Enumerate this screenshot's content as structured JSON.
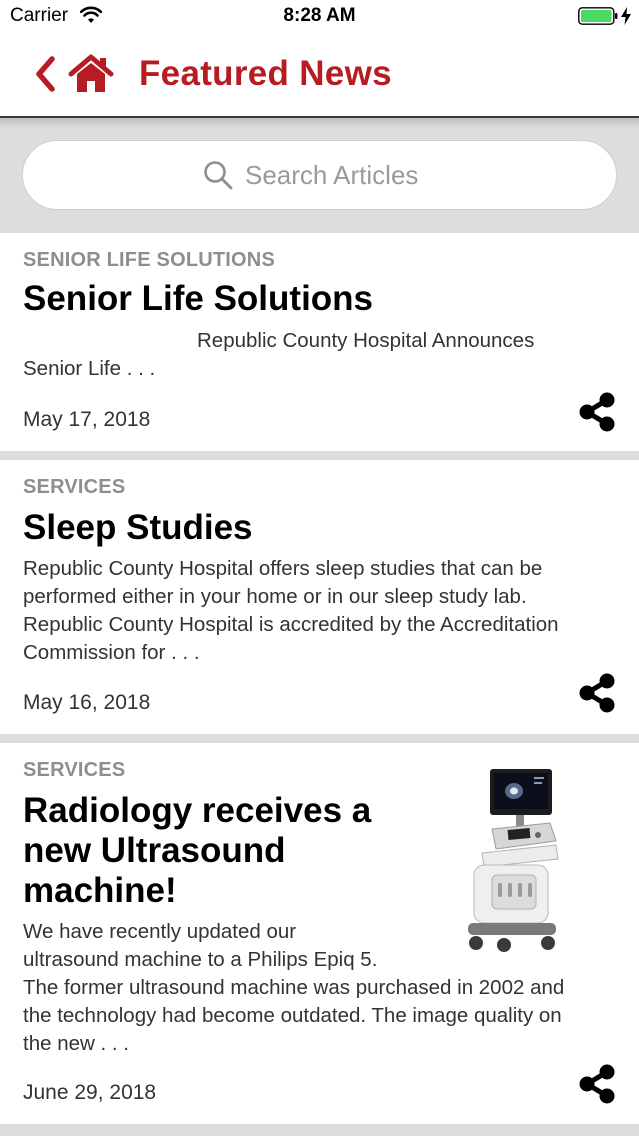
{
  "status_bar": {
    "carrier": "Carrier",
    "time": "8:28 AM",
    "icons": [
      "wifi-icon",
      "battery-icon",
      "charging-icon"
    ],
    "battery_color": "#4cd964"
  },
  "nav": {
    "title": "Featured News",
    "back_icon": "chevron-left-icon",
    "home_icon": "home-icon",
    "accent_color": "#b71c22"
  },
  "search": {
    "placeholder": "Search Articles",
    "value": "",
    "icon": "search-icon"
  },
  "articles": [
    {
      "category": "SENIOR LIFE SOLUTIONS",
      "title": "Senior Life Solutions",
      "excerpt_line1": "Republic County Hospital Announces",
      "excerpt_line2": "Senior Life . . .",
      "date": "May 17, 2018",
      "share_icon": "share-icon"
    },
    {
      "category": "SERVICES",
      "title": "Sleep Studies",
      "excerpt_lines": [
        "Republic County Hospital offers sleep studies that can be",
        "performed either in your home or in our sleep study lab.",
        "Republic County Hospital is accredited by the Accreditation",
        "Commission for . . ."
      ],
      "date": "May 16, 2018",
      "share_icon": "share-icon"
    },
    {
      "category": "SERVICES",
      "title_lines": [
        "Radiology receives a",
        "new Ultrasound",
        "machine!"
      ],
      "excerpt_lines": [
        "We have recently updated our",
        "ultrasound machine to a Philips Epiq 5.",
        "The former ultrasound machine was purchased in 2002 and",
        "the technology had become outdated. The image quality on",
        "the new . . ."
      ],
      "date": "June 29, 2018",
      "image": "ultrasound-machine-image",
      "share_icon": "share-icon"
    }
  ]
}
